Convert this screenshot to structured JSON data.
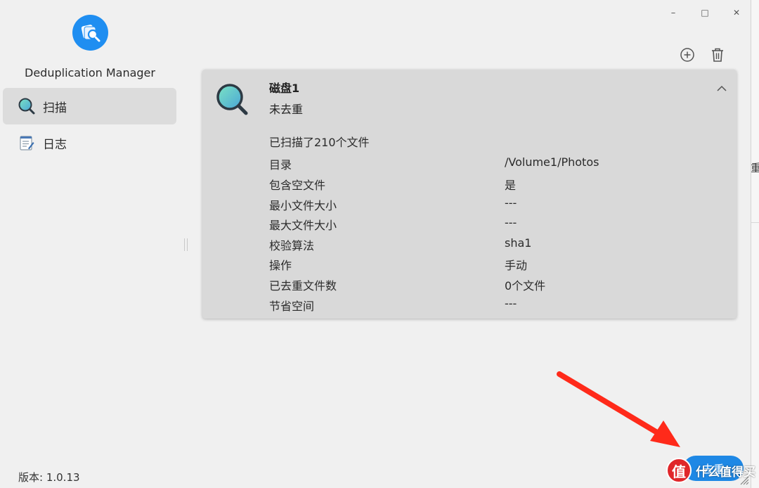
{
  "app": {
    "name": "Deduplication Manager",
    "version_label": "版本: 1.0.13"
  },
  "window_controls": {
    "minimize": "–",
    "maximize": "□",
    "close": "✕"
  },
  "sidebar": {
    "items": [
      {
        "label": "扫描",
        "icon": "scan-magnifier-icon",
        "active": true
      },
      {
        "label": "日志",
        "icon": "log-notepad-icon",
        "active": false
      }
    ]
  },
  "toolbar": {
    "add_icon": "add-circle-icon",
    "delete_icon": "trash-icon"
  },
  "task": {
    "title": "磁盘1",
    "status": "未去重",
    "summary": "已扫描了210个文件",
    "rows": [
      {
        "key": "目录",
        "value": "/Volume1/Photos"
      },
      {
        "key": "包含空文件",
        "value": "是"
      },
      {
        "key": "最小文件大小",
        "value": "---"
      },
      {
        "key": "最大文件大小",
        "value": "---"
      },
      {
        "key": "校验算法",
        "value": "sha1"
      },
      {
        "key": "操作",
        "value": "手动"
      },
      {
        "key": "已去重文件数",
        "value": "0个文件"
      },
      {
        "key": "节省空间",
        "value": "---"
      }
    ]
  },
  "actions": {
    "dedup_label": "去重"
  },
  "overlay": {
    "arrow_color": "#ff2a1a",
    "watermark_text": "什么值得买",
    "watermark_logo": "值"
  },
  "behind_window_fragment": "重",
  "colors": {
    "accent": "#1e88e5",
    "card_bg": "#d9d9d9",
    "active_nav": "#dcdcdc"
  }
}
